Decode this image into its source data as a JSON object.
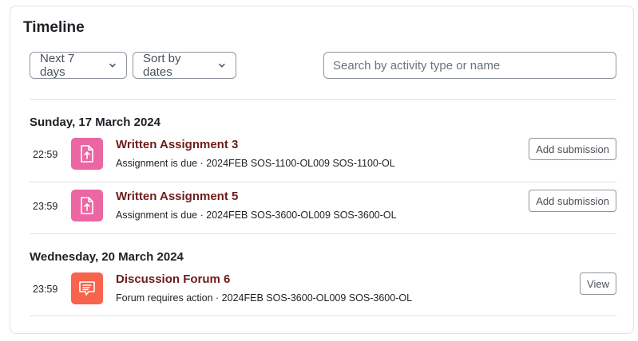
{
  "timeline": {
    "title": "Timeline",
    "filter_days": "Next 7 days",
    "sort": "Sort by dates",
    "search_placeholder": "Search by activity type or name"
  },
  "groups": [
    {
      "date": "Sunday, 17 March 2024",
      "events": [
        {
          "time": "22:59",
          "icon": "assignment-upload-icon",
          "name": "Written Assignment 3",
          "meta": "Assignment is due · 2024FEB SOS-1100-OL009 SOS-1100-OL",
          "action": "Add submission"
        },
        {
          "time": "23:59",
          "icon": "assignment-upload-icon",
          "name": "Written Assignment 5",
          "meta": "Assignment is due · 2024FEB SOS-3600-OL009 SOS-3600-OL",
          "action": "Add submission"
        }
      ]
    },
    {
      "date": "Wednesday, 20 March 2024",
      "events": [
        {
          "time": "23:59",
          "icon": "forum-icon",
          "name": "Discussion Forum 6",
          "meta": "Forum requires action · 2024FEB SOS-3600-OL009 SOS-3600-OL",
          "action": "View"
        }
      ]
    }
  ],
  "colors": {
    "assignment_icon_bg": "#eb66a2",
    "forum_icon_bg": "#f7634d",
    "event_link": "#6e1c1c"
  }
}
